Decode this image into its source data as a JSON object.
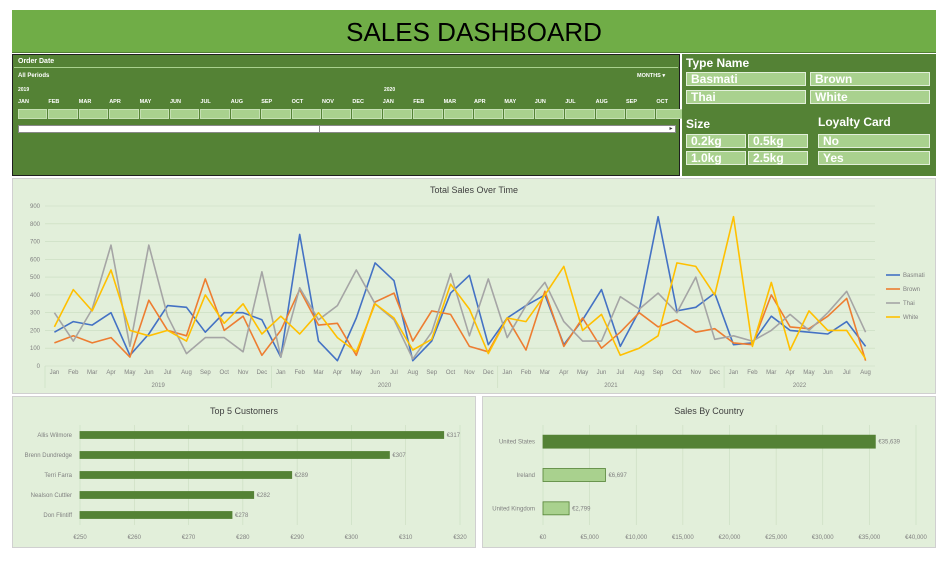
{
  "dashboard": {
    "title": "SALES DASHBOARD"
  },
  "timeline": {
    "label": "Order Date",
    "period": "All Periods",
    "unit": "MONTHS",
    "year1": "2019",
    "year2": "2020",
    "months": [
      "JAN",
      "FEB",
      "MAR",
      "APR",
      "MAY",
      "JUN",
      "JUL",
      "AUG",
      "SEP",
      "OCT",
      "NOV",
      "DEC",
      "JAN",
      "FEB",
      "MAR",
      "APR",
      "MAY",
      "JUN",
      "JUL",
      "AUG",
      "SEP",
      "OCT"
    ]
  },
  "slicers": {
    "type_name": {
      "title": "Type Name",
      "items": [
        "Basmati",
        "Brown",
        "Thai",
        "White"
      ]
    },
    "size": {
      "title": "Size",
      "items": [
        "0.2kg",
        "0.5kg",
        "1.0kg",
        "2.5kg"
      ]
    },
    "loyalty": {
      "title": "Loyalty Card",
      "items": [
        "No",
        "Yes"
      ]
    }
  },
  "colors": {
    "basmati": "#4472c4",
    "brown": "#ed7d31",
    "thai": "#a5a5a5",
    "white": "#ffc000",
    "bar": "#548235",
    "bar_light": "#a9d18e"
  },
  "chart_data": [
    {
      "type": "line",
      "title": "Total Sales Over Time",
      "ylim": [
        0,
        900
      ],
      "yticks": [
        0,
        100,
        200,
        300,
        400,
        500,
        600,
        700,
        800,
        900
      ],
      "x_months": [
        "Jan",
        "Feb",
        "Mar",
        "Apr",
        "May",
        "Jun",
        "Jul",
        "Aug",
        "Sep",
        "Oct",
        "Nov",
        "Dec",
        "Jan",
        "Feb",
        "Mar",
        "Apr",
        "May",
        "Jun",
        "Jul",
        "Aug",
        "Sep",
        "Oct",
        "Nov",
        "Dec",
        "Jan",
        "Feb",
        "Mar",
        "Apr",
        "May",
        "Jun",
        "Jul",
        "Aug",
        "Sep",
        "Oct",
        "Nov",
        "Dec",
        "Jan",
        "Feb",
        "Mar",
        "Apr",
        "May",
        "Jun",
        "Jul",
        "Aug"
      ],
      "x_years": [
        "2019",
        "2020",
        "2021",
        "2022"
      ],
      "legend_position": "right",
      "grid": true,
      "series": [
        {
          "name": "Basmati",
          "color": "#4472c4",
          "values": [
            190,
            250,
            230,
            300,
            60,
            180,
            340,
            330,
            190,
            300,
            300,
            260,
            50,
            740,
            140,
            30,
            270,
            580,
            480,
            30,
            140,
            410,
            510,
            120,
            270,
            340,
            400,
            120,
            260,
            430,
            110,
            310,
            840,
            310,
            330,
            410,
            120,
            130,
            280,
            200,
            190,
            180,
            250,
            110
          ]
        },
        {
          "name": "Brown",
          "color": "#ed7d31",
          "values": [
            130,
            170,
            130,
            160,
            50,
            370,
            200,
            170,
            490,
            200,
            280,
            60,
            200,
            430,
            230,
            240,
            60,
            360,
            410,
            140,
            310,
            290,
            110,
            80,
            270,
            90,
            420,
            110,
            270,
            100,
            190,
            300,
            220,
            260,
            190,
            210,
            130,
            120,
            400,
            220,
            210,
            280,
            380,
            30
          ]
        },
        {
          "name": "Thai",
          "color": "#a5a5a5",
          "values": [
            300,
            140,
            320,
            680,
            110,
            680,
            280,
            70,
            160,
            160,
            80,
            530,
            50,
            440,
            260,
            340,
            540,
            350,
            260,
            40,
            190,
            520,
            170,
            490,
            160,
            340,
            470,
            250,
            140,
            140,
            390,
            320,
            410,
            300,
            500,
            150,
            170,
            140,
            200,
            290,
            200,
            300,
            420,
            190
          ]
        },
        {
          "name": "White",
          "color": "#ffc000",
          "values": [
            220,
            430,
            310,
            540,
            200,
            170,
            200,
            140,
            400,
            240,
            350,
            180,
            280,
            180,
            300,
            160,
            80,
            350,
            270,
            90,
            150,
            460,
            320,
            70,
            270,
            250,
            400,
            560,
            200,
            290,
            60,
            100,
            170,
            580,
            560,
            400,
            840,
            110,
            470,
            90,
            310,
            200,
            200,
            40
          ]
        }
      ]
    },
    {
      "type": "bar",
      "title": "Top 5 Customers",
      "categories": [
        "Allis Wilmore",
        "Brenn Dundredge",
        "Terri Farra",
        "Nealson Cuttler",
        "Don Flintiff"
      ],
      "values": [
        317,
        307,
        289,
        282,
        278
      ],
      "labels": [
        "€317",
        "€307",
        "€289",
        "€282",
        "€278"
      ],
      "xlim": [
        250,
        320
      ],
      "xticks": [
        "€250",
        "€260",
        "€270",
        "€280",
        "€290",
        "€300",
        "€310",
        "€320"
      ]
    },
    {
      "type": "bar",
      "title": "Sales By Country",
      "categories": [
        "United States",
        "Ireland",
        "United Kingdom"
      ],
      "values": [
        35639,
        6697,
        2799
      ],
      "labels": [
        "€35,639",
        "€6,697",
        "€2,799"
      ],
      "xlim": [
        0,
        40000
      ],
      "xticks": [
        "€0",
        "€5,000",
        "€10,000",
        "€15,000",
        "€20,000",
        "€25,000",
        "€30,000",
        "€35,000",
        "€40,000"
      ]
    }
  ]
}
